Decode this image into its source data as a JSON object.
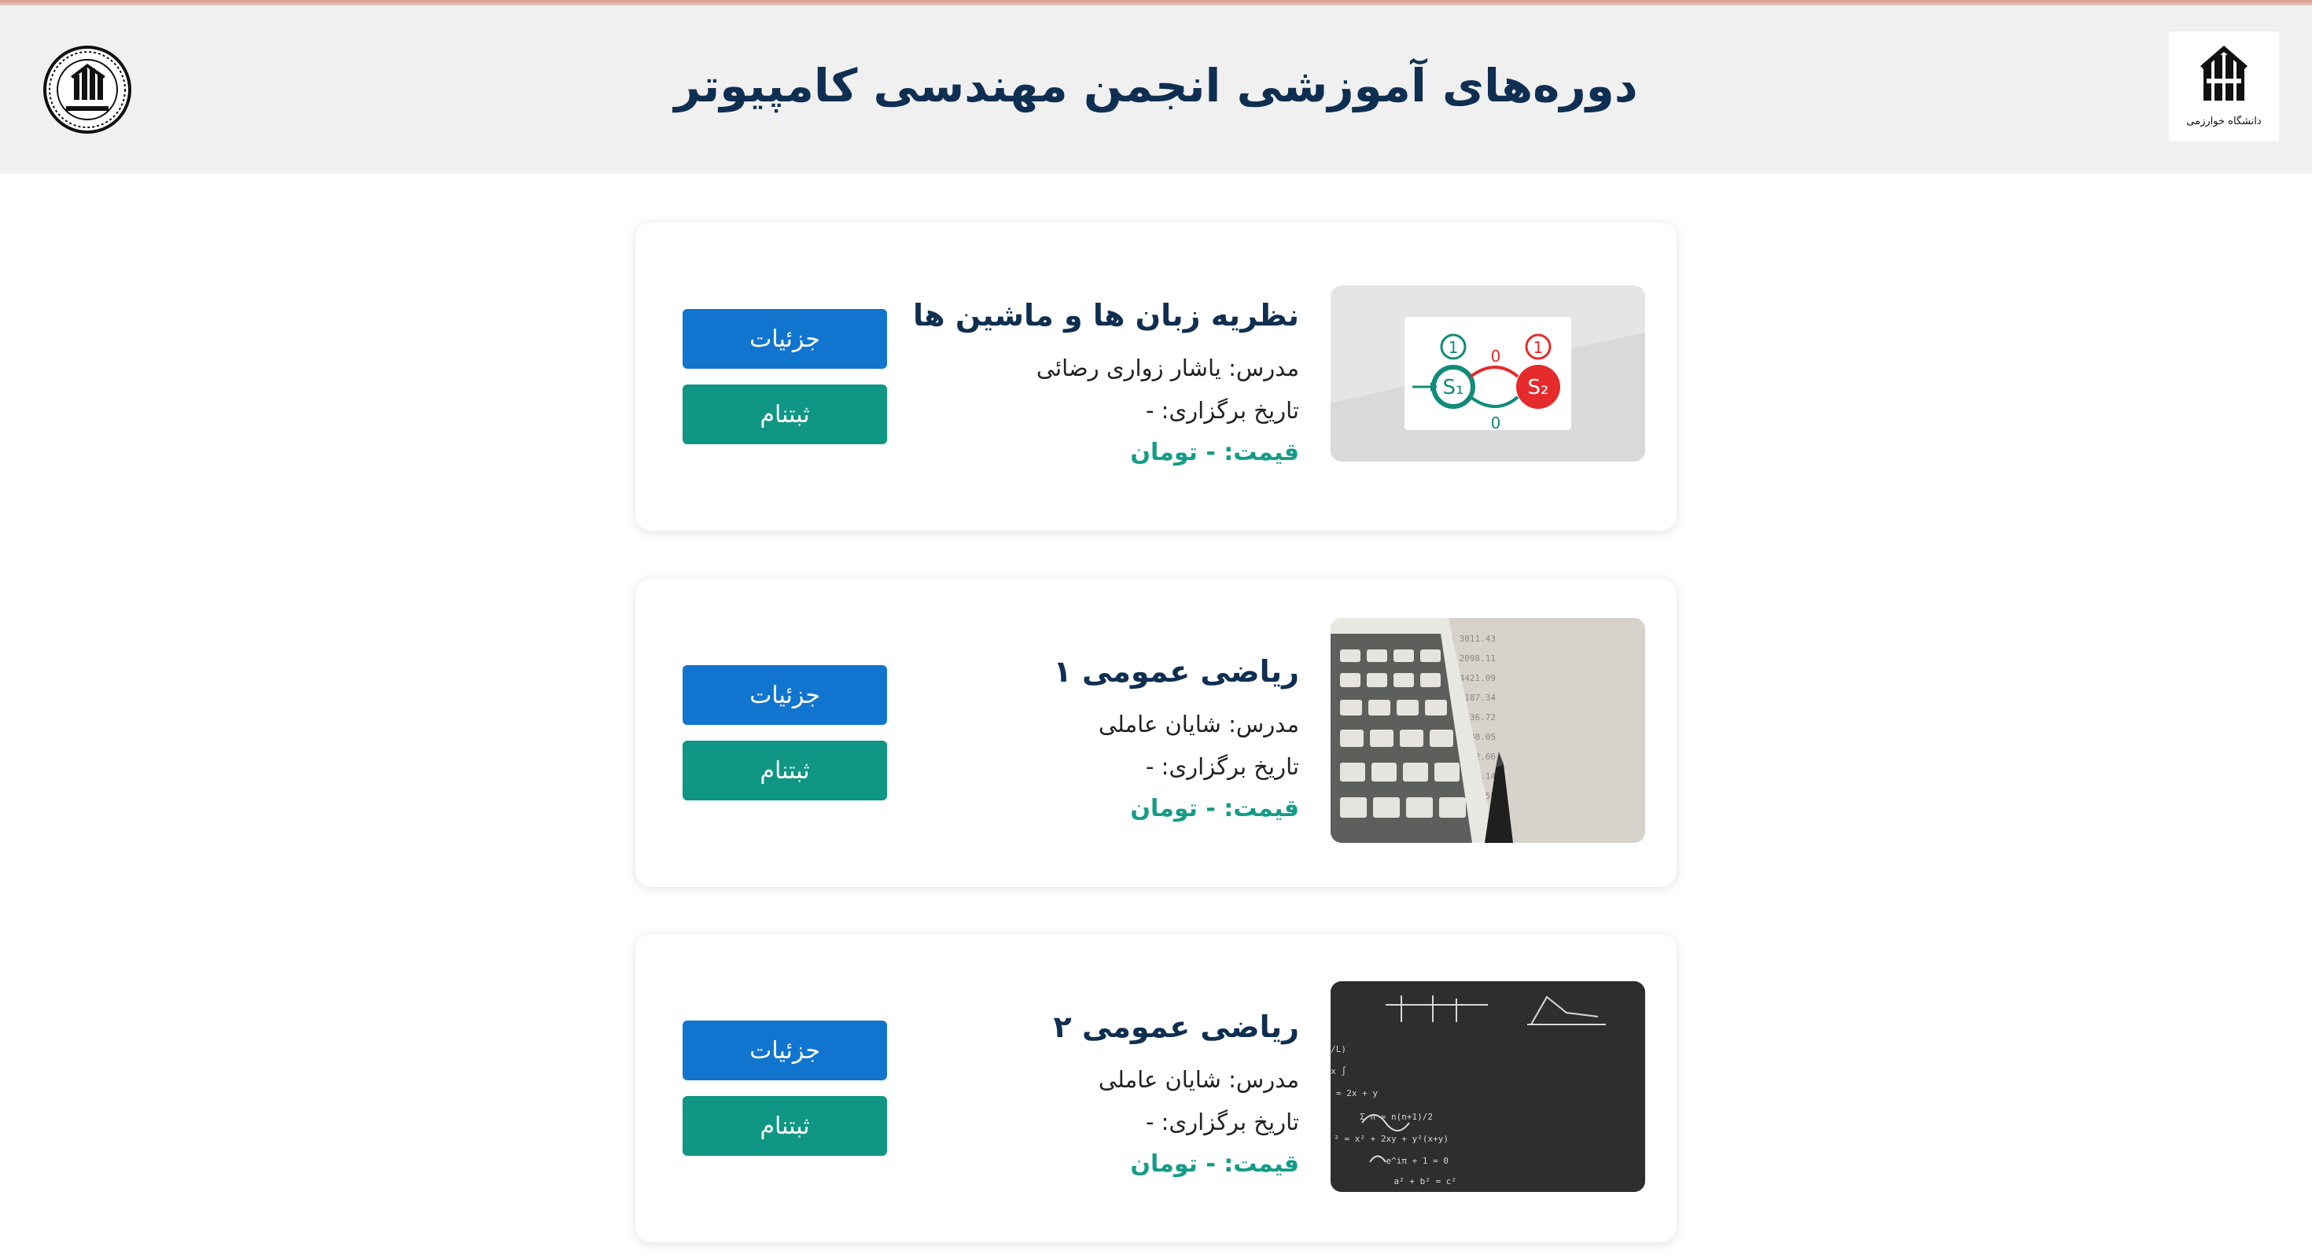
{
  "header": {
    "title": "دوره‌های آموزشی انجمن مهندسی کامپیوتر",
    "right_logo_text": "دانشگاه خوارزمی"
  },
  "courses": [
    {
      "title": "نظریه زبان ها و ماشین ها",
      "instructor": "مدرس: یاشار زواری رضائی",
      "date": "تاریخ برگزاری: -",
      "price": "قیمت: - تومان",
      "details_label": "جزئیات",
      "register_label": "ثبتنام",
      "image": "automata-diagram"
    },
    {
      "title": "ریاضی عمومی ۱",
      "instructor": "مدرس: شایان عاملی",
      "date": "تاریخ برگزاری: -",
      "price": "قیمت: - تومان",
      "details_label": "جزئیات",
      "register_label": "ثبتنام",
      "image": "calculator-photo"
    },
    {
      "title": "ریاضی عمومی ۲",
      "instructor": "مدرس: شایان عاملی",
      "date": "تاریخ برگزاری: -",
      "price": "قیمت: - تومان",
      "details_label": "جزئیات",
      "register_label": "ثبتنام",
      "image": "chalkboard-photo"
    }
  ],
  "automata": {
    "state1": "S₁",
    "state2": "S₂",
    "loop1": "1",
    "loop2": "1",
    "edge_top": "0",
    "edge_bottom": "0"
  },
  "colors": {
    "title": "#0f2f52",
    "details_button": "#1175cf",
    "register_button": "#0f9684",
    "price": "#149c87"
  }
}
